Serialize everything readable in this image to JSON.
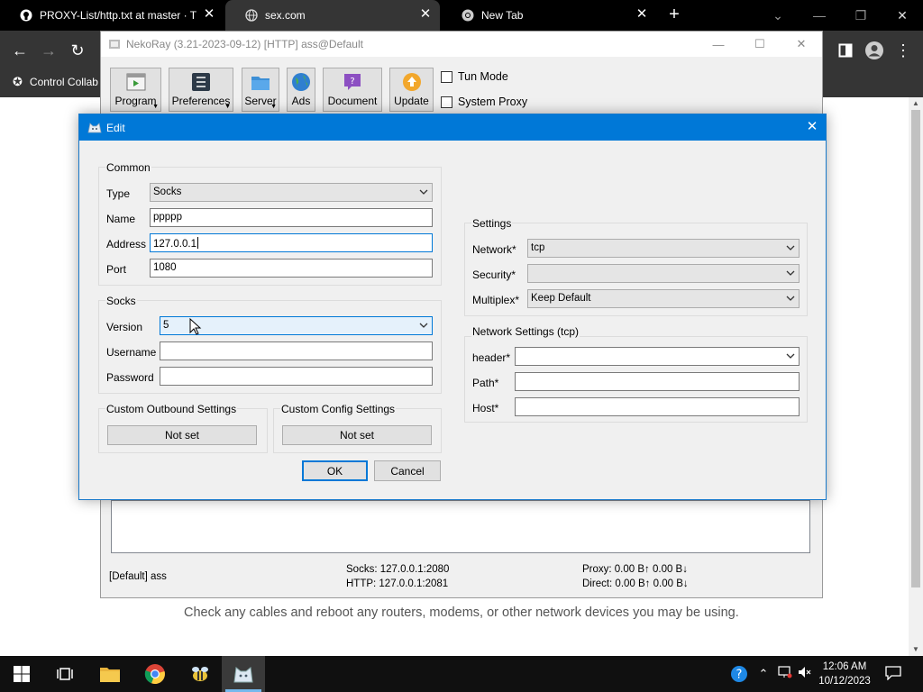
{
  "browser": {
    "tabs": [
      {
        "title": "PROXY-List/http.txt at master · T",
        "active": false,
        "icon": "github-icon"
      },
      {
        "title": "sex.com",
        "active": true,
        "icon": "globe-icon"
      },
      {
        "title": "New Tab",
        "active": false,
        "icon": "chrome-icon"
      }
    ],
    "bookmark_label": "Control Collab",
    "page_message": "Check any cables and reboot any routers, modems, or other network devices you may be using."
  },
  "nekoray": {
    "title": "NekoRay (3.21-2023-09-12) [HTTP] ass@Default",
    "toolbar": {
      "program": "Program",
      "preferences": "Preferences",
      "server": "Server",
      "ads": "Ads",
      "document": "Document",
      "update": "Update"
    },
    "tun_mode": "Tun Mode",
    "system_proxy": "System Proxy",
    "status": {
      "profile": "[Default] ass",
      "socks": "Socks: 127.0.0.1:2080",
      "http": "HTTP: 127.0.0.1:2081",
      "proxy": "Proxy: 0.00 B↑ 0.00 B↓",
      "direct": "Direct: 0.00 B↑ 0.00 B↓"
    }
  },
  "dialog": {
    "title": "Edit",
    "common": {
      "group_title": "Common",
      "type_label": "Type",
      "type_value": "Socks",
      "name_label": "Name",
      "name_value": "ppppp",
      "address_label": "Address",
      "address_value": "127.0.0.1",
      "port_label": "Port",
      "port_value": "1080"
    },
    "socks": {
      "group_title": "Socks",
      "version_label": "Version",
      "version_value": "5",
      "username_label": "Username",
      "username_value": "",
      "password_label": "Password",
      "password_value": ""
    },
    "custom_outbound": {
      "title": "Custom Outbound Settings",
      "button": "Not set"
    },
    "custom_config": {
      "title": "Custom Config Settings",
      "button": "Not set"
    },
    "ok_label": "OK",
    "cancel_label": "Cancel",
    "settings": {
      "group_title": "Settings",
      "network_label": "Network*",
      "network_value": "tcp",
      "security_label": "Security*",
      "security_value": "",
      "multiplex_label": "Multiplex*",
      "multiplex_value": "Keep Default"
    },
    "network_settings": {
      "group_title": "Network Settings (tcp)",
      "header_label": "header*",
      "header_value": "",
      "path_label": "Path*",
      "path_value": "",
      "host_label": "Host*",
      "host_value": ""
    }
  },
  "taskbar": {
    "time": "12:06 AM",
    "date": "10/12/2023"
  }
}
